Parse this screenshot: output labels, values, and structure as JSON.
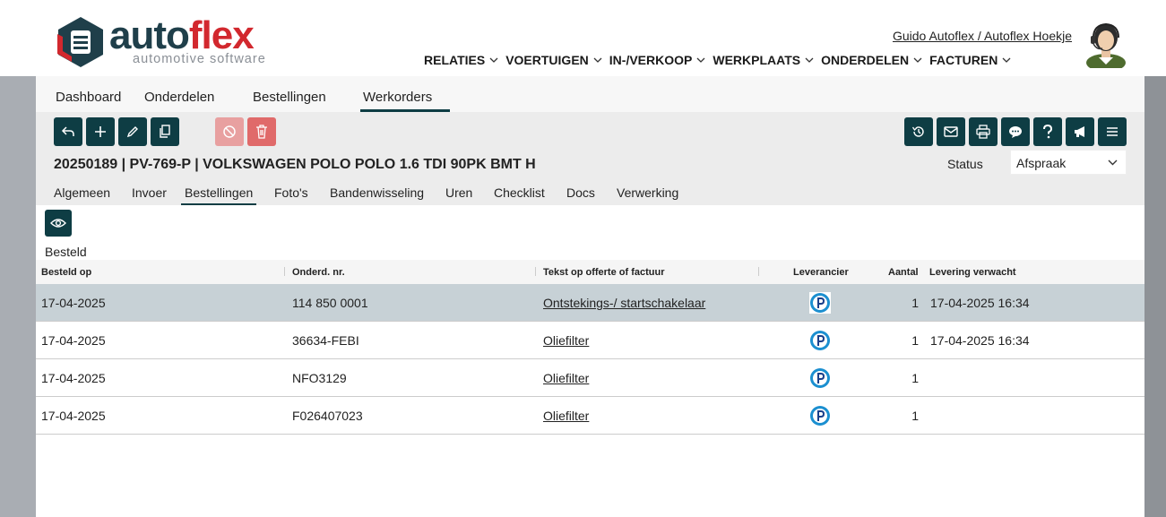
{
  "brand": {
    "name_part1": "auto",
    "name_part2": "flex",
    "tagline": "automotive software"
  },
  "user": {
    "link": "Guido Autoflex / Autoflex Hoekje"
  },
  "main_nav": [
    {
      "label": "RELATIES"
    },
    {
      "label": "VOERTUIGEN"
    },
    {
      "label": "IN-/VERKOOP"
    },
    {
      "label": "WERKPLAATS"
    },
    {
      "label": "ONDERDELEN"
    },
    {
      "label": "FACTUREN"
    }
  ],
  "sub_nav": [
    {
      "label": "Dashboard"
    },
    {
      "label": "Onderdelen"
    },
    {
      "label": "Bestellingen"
    },
    {
      "label": "Werkorders",
      "active": true
    }
  ],
  "toolbar_left": [
    "back-icon",
    "plus-icon",
    "pencil-icon",
    "copy-icon",
    "ban-icon",
    "trash-icon"
  ],
  "toolbar_right": [
    "history-icon",
    "mail-icon",
    "print-icon",
    "chat-icon",
    "help-icon",
    "megaphone-icon",
    "menu-icon"
  ],
  "record": {
    "title": "20250189 | PV-769-P | VOLKSWAGEN POLO POLO 1.6 TDI 90PK BMT H",
    "status_label": "Status",
    "status_value": "Afspraak"
  },
  "detail_tabs": [
    {
      "label": "Algemeen"
    },
    {
      "label": "Invoer"
    },
    {
      "label": "Bestellingen",
      "active": true
    },
    {
      "label": "Foto's"
    },
    {
      "label": "Bandenwisseling"
    },
    {
      "label": "Uren"
    },
    {
      "label": "Checklist"
    },
    {
      "label": "Docs"
    },
    {
      "label": "Verwerking"
    }
  ],
  "section": {
    "title": "Besteld"
  },
  "table": {
    "headers": [
      "Besteld op",
      "Onderd. nr.",
      "Tekst op offerte of factuur",
      "Leverancier",
      "Aantal",
      "Levering verwacht"
    ],
    "rows": [
      {
        "date": "17-04-2025",
        "part": "114 850 0001",
        "text": "Ontstekings-/ startschakelaar",
        "supplier": "supplier-logo-icon",
        "qty": "1",
        "delivery": "17-04-2025 16:34",
        "selected": true
      },
      {
        "date": "17-04-2025",
        "part": "36634-FEBI",
        "text": "Oliefilter",
        "supplier": "supplier-logo-icon",
        "qty": "1",
        "delivery": "17-04-2025 16:34"
      },
      {
        "date": "17-04-2025",
        "part": "NFO3129",
        "text": "Oliefilter",
        "supplier": "supplier-logo-icon",
        "qty": "1",
        "delivery": ""
      },
      {
        "date": "17-04-2025",
        "part": "F026407023",
        "text": "Oliefilter",
        "supplier": "supplier-logo-icon",
        "qty": "1",
        "delivery": ""
      }
    ]
  },
  "colors": {
    "primary": "#0e3d44",
    "danger": "#e06a6a",
    "selected_row": "#c7d1d6",
    "brand_red": "#d2282e"
  }
}
